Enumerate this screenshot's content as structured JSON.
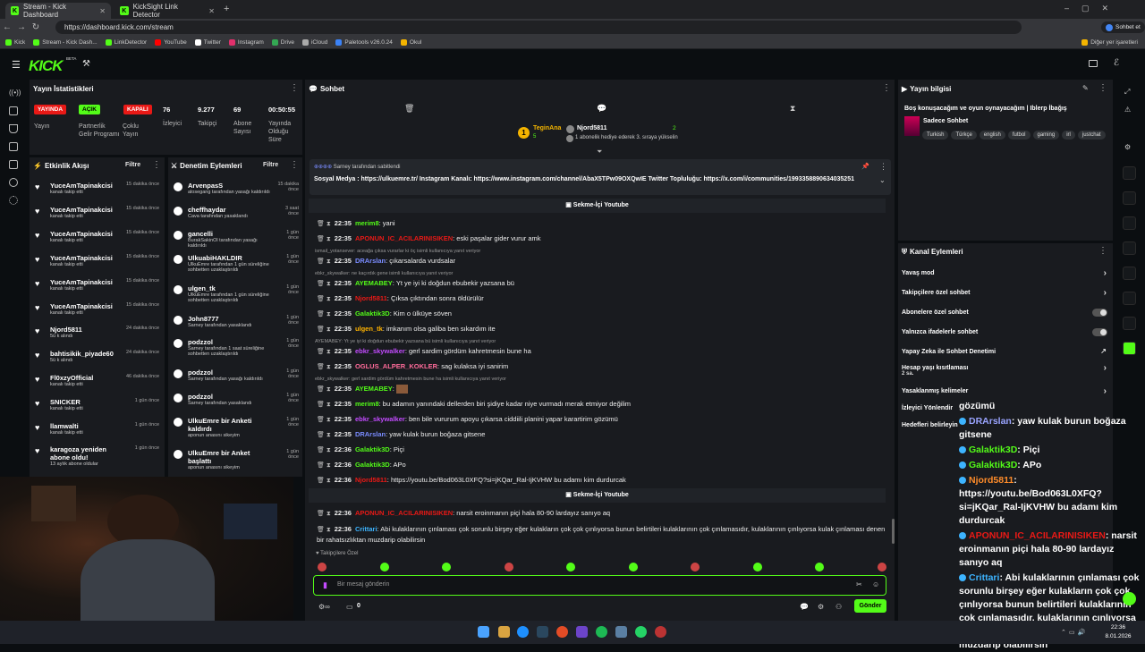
{
  "browser": {
    "tabs": [
      {
        "title": "Stream - Kick Dashboard"
      },
      {
        "title": "KickSight Link Detector"
      }
    ],
    "url": "https://dashboard.kick.com/stream",
    "profile_label": "Sohbet et",
    "bookmarks": [
      "Kick",
      "Stream - Kick Dash...",
      "LinkDetector",
      "YouTube",
      "Twitter",
      "Instagram",
      "Drive",
      "iCloud",
      "Paletools v26.0.24",
      "Okul"
    ],
    "other_bookmarks": "Diğer yer işaretleri"
  },
  "brand": {
    "logo": "KICK",
    "beta": "BETA",
    "accent": "#53fc18"
  },
  "stats": {
    "title": "Yayın İstatistikleri",
    "badges": [
      {
        "text": "YAYINDA",
        "color": "#e91916"
      },
      {
        "text": "AÇIK",
        "color": "#53fc18"
      },
      {
        "text": "KAPALI",
        "color": "#e91916"
      }
    ],
    "badge_labels": [
      "Yayın",
      "Partnerlik Gelir Programı",
      "Çoklu Yayın"
    ],
    "values": [
      "76",
      "9.277",
      "69",
      "00:50:55"
    ],
    "value_labels": [
      "İzleyici",
      "Takipçi",
      "Abone Sayısı",
      "Yayında Olduğu Süre"
    ]
  },
  "activity": {
    "title": "Etkinlik Akışı",
    "filter": "Filtre",
    "items": [
      {
        "name": "YuceAmTapinakcisi",
        "sub": "kanalı takip etti",
        "time": "15 dakika önce"
      },
      {
        "name": "YuceAmTapinakcisi",
        "sub": "kanalı takip etti",
        "time": "15 dakika önce"
      },
      {
        "name": "YuceAmTapinakcisi",
        "sub": "kanalı takip etti",
        "time": "15 dakika önce"
      },
      {
        "name": "YuceAmTapinakcisi",
        "sub": "kanalı takip etti",
        "time": "15 dakika önce"
      },
      {
        "name": "YuceAmTapinakcisi",
        "sub": "kanalı takip etti",
        "time": "15 dakika önce"
      },
      {
        "name": "YuceAmTapinakcisi",
        "sub": "kanalı takip etti",
        "time": "15 dakika önce"
      },
      {
        "name": "Njord5811",
        "sub": "5ü k alındı",
        "time": "24 dakika önce"
      },
      {
        "name": "bahtisikik_piyade60",
        "sub": "5ü k alındı",
        "time": "24 dakika önce"
      },
      {
        "name": "Fl0xzyOfficial",
        "sub": "kanalı takip etti",
        "time": "46 dakika önce"
      },
      {
        "name": "SNICKER",
        "sub": "kanalı takip etti",
        "time": "1 gün önce"
      },
      {
        "name": "llamwalti",
        "sub": "kanalı takip etti",
        "time": "1 gün önce"
      },
      {
        "name": "karagoza yeniden abone oldu!",
        "sub": "13 aylık abone oldular",
        "time": "1 gün önce"
      }
    ]
  },
  "moderation": {
    "title": "Denetim Eylemleri",
    "filter": "Filtre",
    "items": [
      {
        "name": "ArvenpasS",
        "sub": "alosegang tarafından yasağı kaldırıldı",
        "time": "15 dakika önce"
      },
      {
        "name": "cheffhaydar",
        "sub": "Cava tarafından yasaklandı",
        "time": "3 saat önce"
      },
      {
        "name": "gancelli",
        "sub": "BurakSakinOl tarafından yasağı kaldırıldı",
        "time": "1 gün önce"
      },
      {
        "name": "UlkuabiHAKLDIR",
        "sub": "UlkuEmre tarafından 1 gün süreliğine sohbetten uzaklaştırıldı",
        "time": "1 gün önce"
      },
      {
        "name": "ulgen_tk",
        "sub": "UlkuEmre tarafından 1 gün süreliğine sohbetten uzaklaştırıldı",
        "time": "1 gün önce"
      },
      {
        "name": "John8777",
        "sub": "Sarney tarafından yasaklandı",
        "time": "1 gün önce"
      },
      {
        "name": "podzzol",
        "sub": "Sarney tarafından 1 saat süreliğine sohbetten uzaklaştırıldı",
        "time": "1 gün önce"
      },
      {
        "name": "podzzol",
        "sub": "Sarney tarafından yasağı kaldırıldı",
        "time": "1 gün önce"
      },
      {
        "name": "podzzol",
        "sub": "Sarney tarafından yasaklandı",
        "time": "1 gün önce"
      },
      {
        "name": "UlkuEmre bir Anketi kaldırdı",
        "sub": "aponun anasını sikeyim",
        "time": "1 gün önce"
      },
      {
        "name": "UlkuEmre bir Anket başlattı",
        "sub": "aponun anasını sikeyim",
        "time": "1 gün önce"
      }
    ]
  },
  "chat": {
    "title": "Sohbet",
    "top_users": [
      {
        "name": "TeginAna",
        "count": "5"
      },
      {
        "name": "Njord5811",
        "count": "2"
      }
    ],
    "gift_note": "1 abonelik hediye ederek 3. sıraya yükselin",
    "pinned_by": "Sarney tarafından sabitlendi",
    "pinned_text": "Sosyal Medya : https://ulkuemre.tr/ Instagram Kanalı: https://www.instagram.com/channel/AbaX5TPw09OXQwIE Twitter Topluluğu: https://x.com/i/communities/1993358890634035251",
    "source_label": "Sekme-İçi Youtube",
    "messages": [
      {
        "time": "22:35",
        "user": "merim8",
        "color": "#53fc18",
        "text": "yani"
      },
      {
        "time": "22:35",
        "user": "APONUN_IC_ACILARINISIKEN",
        "color": "#e91916",
        "text": "eski paşalar gider vurur amk"
      },
      {
        "reply": "ismail_yotansever: aceağa çıksa vurarlar ki öç isimli kullanıcıya yanıt veriyor"
      },
      {
        "time": "22:35",
        "user": "DRArslan",
        "color": "#7a8cff",
        "text": "çıkarsalarda vurdsalar"
      },
      {
        "reply": "ebkr_skywalker: ne kaçırdık gene isimli kullanıcıya yanıt veriyor"
      },
      {
        "time": "22:35",
        "user": "AYEMABEY",
        "color": "#53fc18",
        "text": "Yt ye iyi ki doğdun ebubekir yazsana bü"
      },
      {
        "time": "22:35",
        "user": "Njord5811",
        "color": "#e91916",
        "text": "Çıksa çıktından sonra öldürülür"
      },
      {
        "time": "22:35",
        "user": "Galaktik3D",
        "color": "#53fc18",
        "text": "Kim o ülküye söven"
      },
      {
        "time": "22:35",
        "user": "ulgen_tk",
        "color": "#ffb300",
        "text": "imkanım olsa galiba ben sıkardım ite"
      },
      {
        "reply": "AYEMABEY: Yt ye iyi ki doğdun ebubekir yazsana bü isimli kullanıcıya yanıt veriyor"
      },
      {
        "time": "22:35",
        "user": "ebkr_skywalker",
        "color": "#c34bff",
        "text": "gerl sardim gördüm kahretmesin bune ha"
      },
      {
        "time": "22:35",
        "user": "OGLUS_ALPER_KOKLER",
        "color": "#ff6b9a",
        "text": "sag kulaksa iyi sanirim"
      },
      {
        "reply": "ebkr_skywalker: gerl sardim gördüm kahretmesin bune ha isimli kullanıcıya yanıt veriyor"
      },
      {
        "time": "22:35",
        "user": "AYEMABEY",
        "color": "#53fc18",
        "text": ""
      },
      {
        "time": "22:35",
        "user": "merim8",
        "color": "#53fc18",
        "text": "bu adamın yanındaki dellerden biri şidiye kadar niye vurmadı merak etmiyor değilim"
      },
      {
        "time": "22:35",
        "user": "ebkr_skywalker",
        "color": "#c34bff",
        "text": "ben bile vururum apoyu çıkarsa ciddiili planini yapar karartirim gözümü"
      },
      {
        "time": "22:35",
        "user": "DRArslan",
        "color": "#7a8cff",
        "text": "yaw kulak burun boğaza gitsene"
      },
      {
        "time": "22:36",
        "user": "Galaktik3D",
        "color": "#53fc18",
        "text": "Piçi"
      },
      {
        "time": "22:36",
        "user": "Galaktik3D",
        "color": "#53fc18",
        "text": "APo"
      },
      {
        "time": "22:36",
        "user": "Njord5811",
        "color": "#e91916",
        "text": "https://youtu.be/Bod063L0XFQ?si=jKQar_Ral-IjKVHW bu adamı kim durdurcak"
      },
      {
        "time": "22:36",
        "user": "APONUN_IC_ACILARINISIKEN",
        "color": "#e91916",
        "text": "narsit eroinmanın piçi hala 80-90 lardayız sanıyo aq"
      },
      {
        "time": "22:36",
        "user": "Crittari",
        "color": "#3db4ff",
        "text": "Abi kulaklarının çınlaması çok sorunlu birşey eğer kulakların çok çok çınlıyorsa bunun belirtileri kulaklarının çok çınlamasıdır, kulaklarının çınlıyorsa kulak çınlaması denen bir rahatsızlıktan muzdarip olabilirsin"
      }
    ],
    "subscribers_label": "Takipçilere Özel",
    "input_placeholder": "Bir mesaj gönderin",
    "send_label": "Gönder",
    "bits_count": "0"
  },
  "stream_info": {
    "title": "Yayın bilgisi",
    "stream_title": "Boş konuşacağım ve oyun oynayacağım | Iblerp İbağış",
    "category": "Sadece Sohbet",
    "tags": [
      "Turkish",
      "Türkçe",
      "english",
      "futbol",
      "gaming",
      "irl",
      "justchat"
    ]
  },
  "channel_actions": {
    "title": "Kanal Eylemleri",
    "rows": [
      {
        "label": "Yavaş mod",
        "type": "chevron"
      },
      {
        "label": "Takipçilere özel sohbet",
        "type": "chevron"
      },
      {
        "label": "Abonelere özel sohbet",
        "type": "toggle"
      },
      {
        "label": "Yalnızca ifadelerle sohbet",
        "type": "toggle"
      },
      {
        "label": "Yapay Zeka ile Sohbet Denetimi",
        "type": "link"
      },
      {
        "label": "Hesap yaşı kısıtlaması",
        "sub": "2 sa.",
        "type": "chevron"
      },
      {
        "label": "Yasaklanmış kelimeler",
        "type": "chevron"
      },
      {
        "label": "İzleyici Yönlendir",
        "type": "none"
      },
      {
        "label": "Hedefleri belirleyin",
        "type": "none"
      }
    ]
  },
  "overlay_chat": [
    {
      "user": "",
      "text": "gözümü"
    },
    {
      "user": "DRArslan",
      "color": "#9aa4ff",
      "text": ": yaw kulak burun boğaza gitsene"
    },
    {
      "user": "Galaktik3D",
      "color": "#53fc18",
      "text": ": Piçi"
    },
    {
      "user": "Galaktik3D",
      "color": "#53fc18",
      "text": ": APo"
    },
    {
      "user": "Njord5811",
      "color": "#ff8c2a",
      "text": ": https://youtu.be/Bod063L0XFQ?si=jKQar_Ral-IjKVHW bu adamı kim durdurcak"
    },
    {
      "user": "APONUN_IC_ACILARINISIKEN",
      "color": "#e91916",
      "text": ": narsit eroinmanın piçi hala 80-90 lardayız sanıyo aq"
    },
    {
      "user": "Crittari",
      "color": "#3db4ff",
      "text": ": Abi kulaklarının çınlaması çok sorunlu birşey eğer kulakların çok çok çınlıyorsa bunun belirtileri kulaklarının çok çınlamasıdır, kulaklarının çınlıyorsa kulak çınlaması denen bir rahatsızlıktan muzdarip olabilirsin"
    }
  ],
  "taskbar": {
    "time": "22:36",
    "date": "8.01.2026"
  }
}
